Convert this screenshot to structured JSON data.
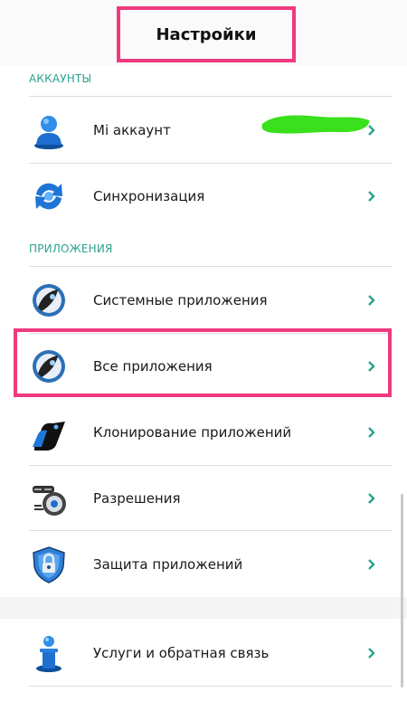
{
  "header": {
    "title": "Настройки"
  },
  "sections": {
    "accounts": {
      "header": "АККАУНТЫ",
      "items": [
        {
          "label": "Mi аккаунт",
          "icon": "user-icon"
        },
        {
          "label": "Синхронизация",
          "icon": "sync-icon"
        }
      ]
    },
    "apps": {
      "header": "ПРИЛОЖЕНИЯ",
      "items": [
        {
          "label": "Системные приложения",
          "icon": "system-apps-icon"
        },
        {
          "label": "Все приложения",
          "icon": "all-apps-icon"
        },
        {
          "label": "Клонирование приложений",
          "icon": "clone-apps-icon"
        },
        {
          "label": "Разрешения",
          "icon": "permissions-icon"
        },
        {
          "label": "Защита приложений",
          "icon": "shield-lock-icon"
        }
      ]
    },
    "feedback": {
      "items": [
        {
          "label": "Услуги и обратная связь",
          "icon": "info-icon"
        }
      ]
    }
  },
  "colors": {
    "accent": "#2aa28e",
    "highlight": "#ee3a7f",
    "scribble": "#39e01b",
    "icon_blue": "#1e6fd0"
  }
}
